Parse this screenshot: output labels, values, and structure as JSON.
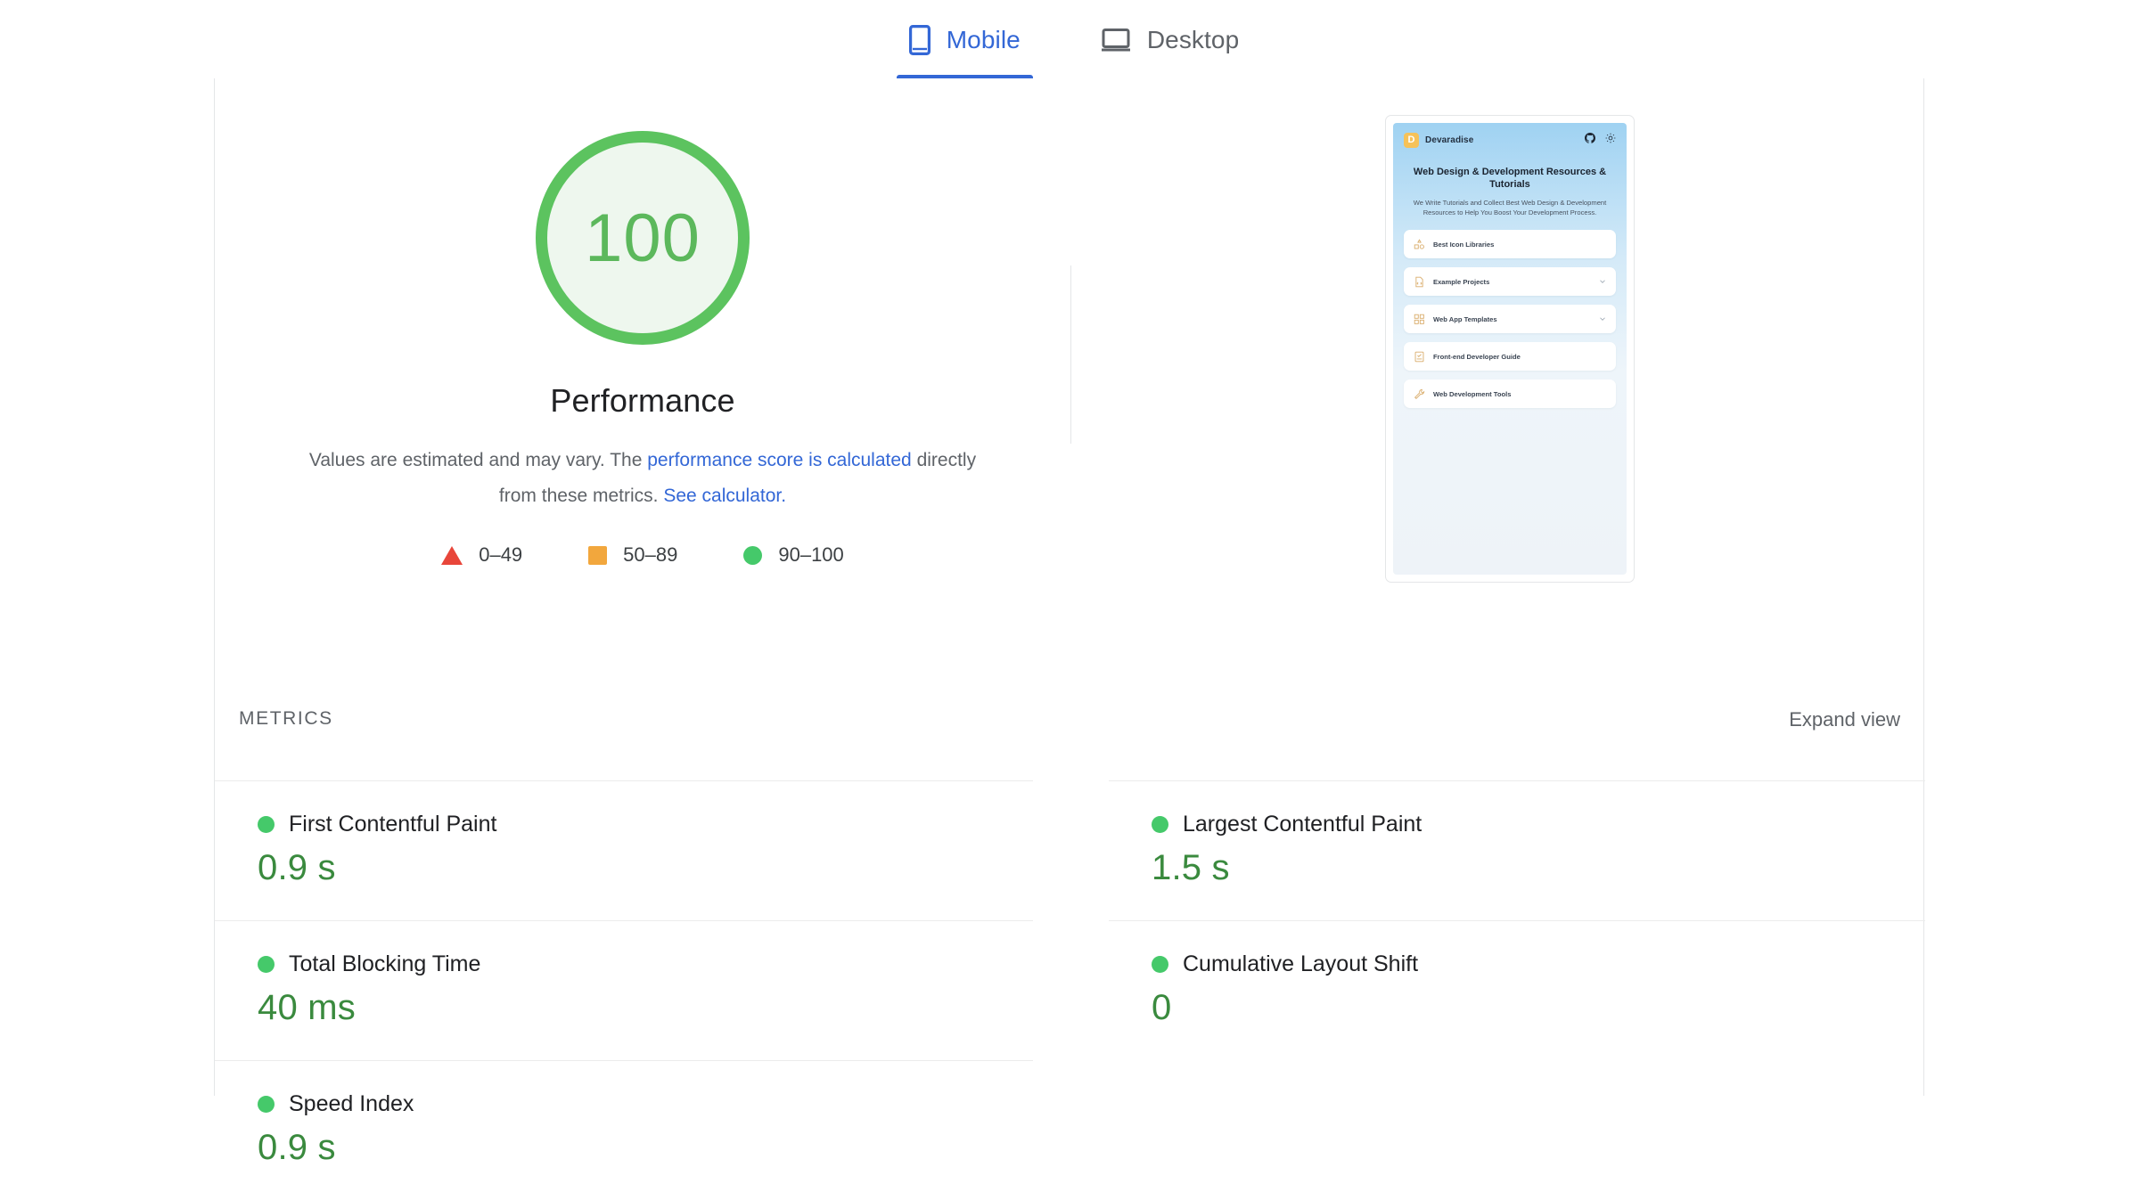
{
  "tabs": [
    {
      "label": "Mobile",
      "icon": "mobile-icon",
      "active": true
    },
    {
      "label": "Desktop",
      "icon": "desktop-icon",
      "active": false
    }
  ],
  "score": {
    "value": "100",
    "title": "Performance",
    "ring_color": "#5cc35f",
    "fill_color": "#eef7ee",
    "text_color": "#5cb85c"
  },
  "description": {
    "part1": "Values are estimated and may vary. The ",
    "link1": "performance score is calculated",
    "part2": " directly from these metrics. ",
    "link2": "See calculator.",
    "link_color": "#3367d6"
  },
  "legend": [
    {
      "shape": "triangle",
      "label": "0–49",
      "color": "#e8463a"
    },
    {
      "shape": "square",
      "label": "50–89",
      "color": "#f2a73d"
    },
    {
      "shape": "circle",
      "label": "90–100",
      "color": "#45c96a"
    }
  ],
  "metrics_section": {
    "title": "METRICS",
    "expand_label": "Expand view"
  },
  "metrics": {
    "left": [
      {
        "name": "First Contentful Paint",
        "value": "0.9 s",
        "status": "good"
      },
      {
        "name": "Total Blocking Time",
        "value": "40 ms",
        "status": "good"
      },
      {
        "name": "Speed Index",
        "value": "0.9 s",
        "status": "good"
      }
    ],
    "right": [
      {
        "name": "Largest Contentful Paint",
        "value": "1.5 s",
        "status": "good"
      },
      {
        "name": "Cumulative Layout Shift",
        "value": "0",
        "status": "good"
      }
    ]
  },
  "thumbnail": {
    "brand": "Devaradise",
    "logo_letter": "D",
    "logo_color": "#f6c259",
    "header_icons": [
      "github-icon",
      "sun-icon"
    ],
    "headline": "Web Design & Development Resources & Tutorials",
    "subtext": "We Write Tutorials and Collect Best Web Design & Development Resources to Help You Boost Your Development Process.",
    "items": [
      {
        "label": "Best Icon Libraries",
        "icon": "shapes-icon",
        "chevron": false
      },
      {
        "label": "Example Projects",
        "icon": "code-file-icon",
        "chevron": true
      },
      {
        "label": "Web App Templates",
        "icon": "grid-icon",
        "chevron": true
      },
      {
        "label": "Front-end Developer Guide",
        "icon": "checklist-icon",
        "chevron": false
      },
      {
        "label": "Web Development Tools",
        "icon": "wrench-icon",
        "chevron": false
      }
    ]
  }
}
